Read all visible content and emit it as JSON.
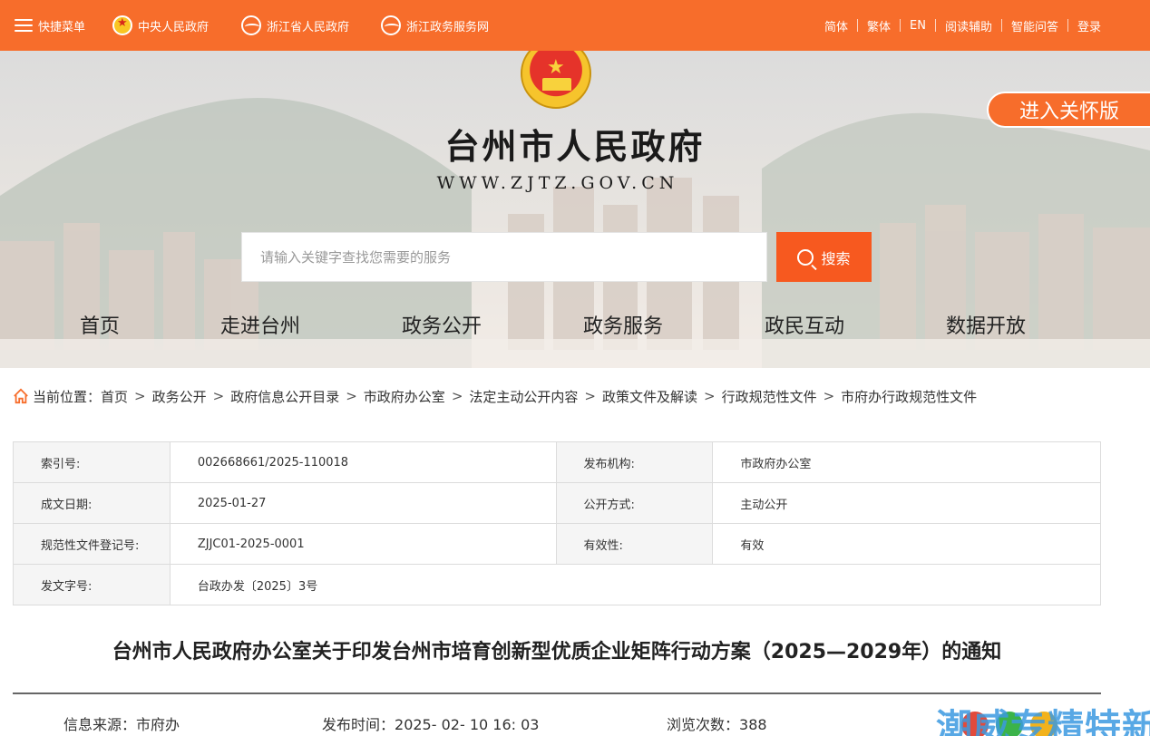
{
  "topbar": {
    "quick_menu": "快捷菜单",
    "links": [
      "中央人民政府",
      "浙江省人民政府",
      "浙江政务服务网"
    ],
    "right_links": [
      "简体",
      "繁体",
      "EN",
      "阅读辅助",
      "智能问答",
      "登录"
    ]
  },
  "banner": {
    "title": "台州市人民政府",
    "url": "WWW.ZJTZ.GOV.CN",
    "care_button": "进入关怀版",
    "search_placeholder": "请输入关键字查找您需要的服务",
    "search_button": "搜索"
  },
  "nav": [
    "首页",
    "走进台州",
    "政务公开",
    "政务服务",
    "政民互动",
    "数据开放"
  ],
  "breadcrumb": {
    "label": "当前位置：",
    "items": [
      "首页",
      "政务公开",
      "政府信息公开目录",
      "市政府办公室",
      "法定主动公开内容",
      "政策文件及解读",
      "行政规范性文件",
      "市府办行政规范性文件"
    ]
  },
  "meta": {
    "index_label": "索引号:",
    "index_value": "002668661/2025-110018",
    "org_label": "发布机构:",
    "org_value": "市政府办公室",
    "date_label": "成文日期:",
    "date_value": "2025-01-27",
    "mode_label": "公开方式:",
    "mode_value": "主动公开",
    "reg_label": "规范性文件登记号:",
    "reg_value": "ZJJC01-2025-0001",
    "valid_label": "有效性:",
    "valid_value": "有效",
    "docno_label": "发文字号:",
    "docno_value": "台政办发〔2025〕3号"
  },
  "article": {
    "title": "台州市人民政府办公室关于印发台州市培育创新型优质企业矩阵行动方案（2025—2029年）的通知",
    "source_label": "信息来源：",
    "source_value": "市府办",
    "time_label": "发布时间：",
    "time_value": "2025- 02- 10 16: 03",
    "views_label": "浏览次数：",
    "views_value": "388"
  },
  "watermark": "潮威专精特新",
  "colors": {
    "brand": "#f76d2b",
    "search": "#f7591f"
  }
}
